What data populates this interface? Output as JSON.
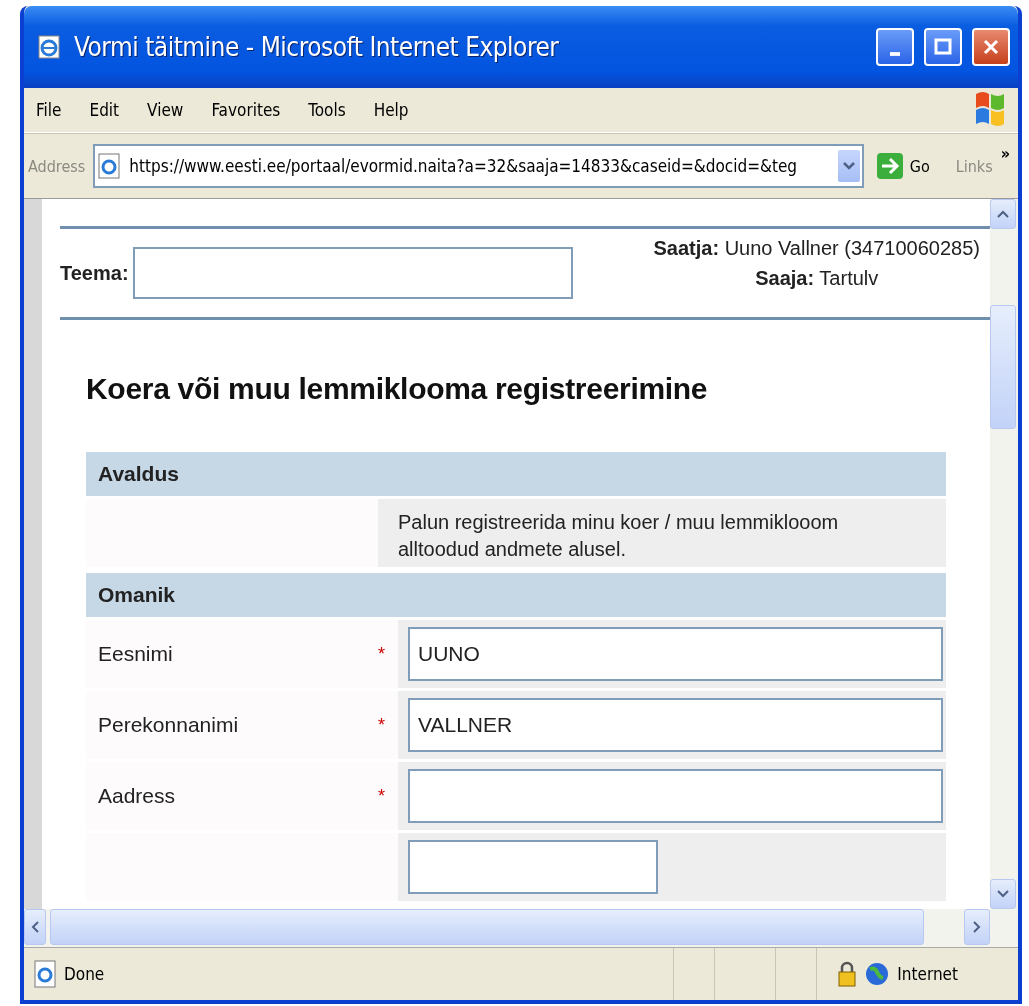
{
  "window": {
    "title": "Vormi täitmine - Microsoft Internet Explorer"
  },
  "menu": [
    "File",
    "Edit",
    "View",
    "Favorites",
    "Tools",
    "Help"
  ],
  "address_bar": {
    "label": "Address",
    "url": "https://www.eesti.ee/portaal/evormid.naita?a=32&saaja=14833&caseid=&docid=&teg",
    "go": "Go",
    "links": "Links",
    "more": "»"
  },
  "page": {
    "subject_label": "Teema:",
    "sender_label": "Saatja:",
    "sender_value": "Uuno Vallner (34710060285)",
    "recipient_label": "Saaja:",
    "recipient_value": "Tartulv",
    "heading": "Koera või muu lemmiklooma registreerimine",
    "sections": [
      {
        "title": "Avaldus",
        "rows": [
          {
            "kind": "text",
            "text": "Palun registreerida minu koer / muu lemmiklooom alltoodud andmete alusel."
          }
        ]
      },
      {
        "title": "Omanik",
        "required_mark": "*",
        "rows": [
          {
            "kind": "field",
            "label": "Eesnimi",
            "required": true,
            "value": "UUNO"
          },
          {
            "kind": "field",
            "label": "Perekonnanimi",
            "required": true,
            "value": "VALLNER"
          },
          {
            "kind": "field",
            "label": "Aadress",
            "required": true,
            "value": ""
          },
          {
            "kind": "short-field",
            "required": false,
            "value": ""
          }
        ]
      }
    ]
  },
  "status_bar": {
    "text": "Done",
    "zone": "Internet"
  }
}
